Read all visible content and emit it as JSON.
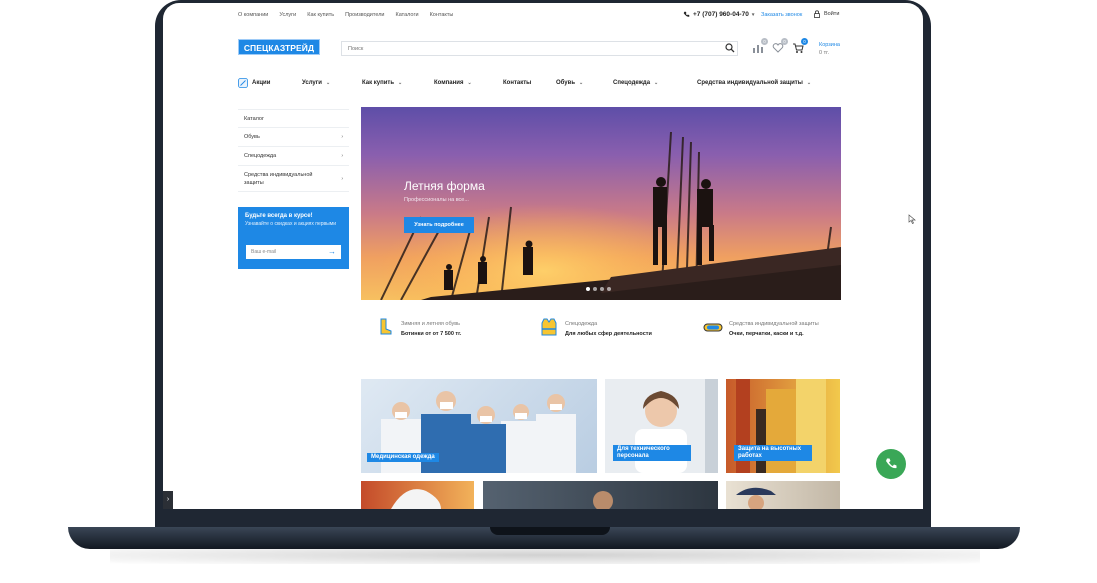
{
  "topbar": {
    "links": [
      "О компании",
      "Услуги",
      "Как купить",
      "Производители",
      "Каталоги",
      "Контакты"
    ],
    "phone": "+7 (707) 960-04-70",
    "callback": "Заказать звонок",
    "login": "Войти"
  },
  "header": {
    "logo": "СПЕЦКАЗТРЕЙД",
    "search_placeholder": "Поиск",
    "compare_count": "0",
    "favorites_count": "0",
    "cart_count": "0",
    "cart_label": "Корзина",
    "cart_sum": "0 тг."
  },
  "nav": {
    "items": [
      {
        "label": "Акции"
      },
      {
        "label": "Услуги"
      },
      {
        "label": "Как купить"
      },
      {
        "label": "Компания"
      },
      {
        "label": "Контакты"
      },
      {
        "label": "Обувь"
      },
      {
        "label": "Спецодежда"
      },
      {
        "label": "Средства индивидуальной защиты"
      }
    ]
  },
  "sidebar": {
    "items": [
      "Каталог",
      "Обувь",
      "Спецодежда",
      "Средства индивидуальной защиты"
    ]
  },
  "subscribe": {
    "title": "Будьте всегда в курсе!",
    "text": "Узнавайте о скидках и акциях первыми",
    "placeholder": "Ваш e-mail"
  },
  "hero": {
    "title": "Летняя форма",
    "subtitle": "Профессионалы на все...",
    "button": "Узнать подробнее",
    "slides": 4,
    "active_slide": 1
  },
  "features": [
    {
      "line1": "Зимняя и летняя обувь",
      "line2": "Ботинки от от 7 500 тг.",
      "icon": "boot-icon"
    },
    {
      "line1": "Спецодежда",
      "line2": "Для любых сфер деятельности",
      "icon": "vest-icon"
    },
    {
      "line1": "Средства индивидуальной защиты",
      "line2": "Очки, перчатки, каски и т.д.",
      "icon": "goggles-icon"
    }
  ],
  "tiles": [
    {
      "label": "Медицинская одежда"
    },
    {
      "label": "Для технического персонала"
    },
    {
      "label": "Защита на высотных работах"
    }
  ],
  "colors": {
    "accent": "#1e88e5",
    "whatsapp": "#3aa757"
  }
}
